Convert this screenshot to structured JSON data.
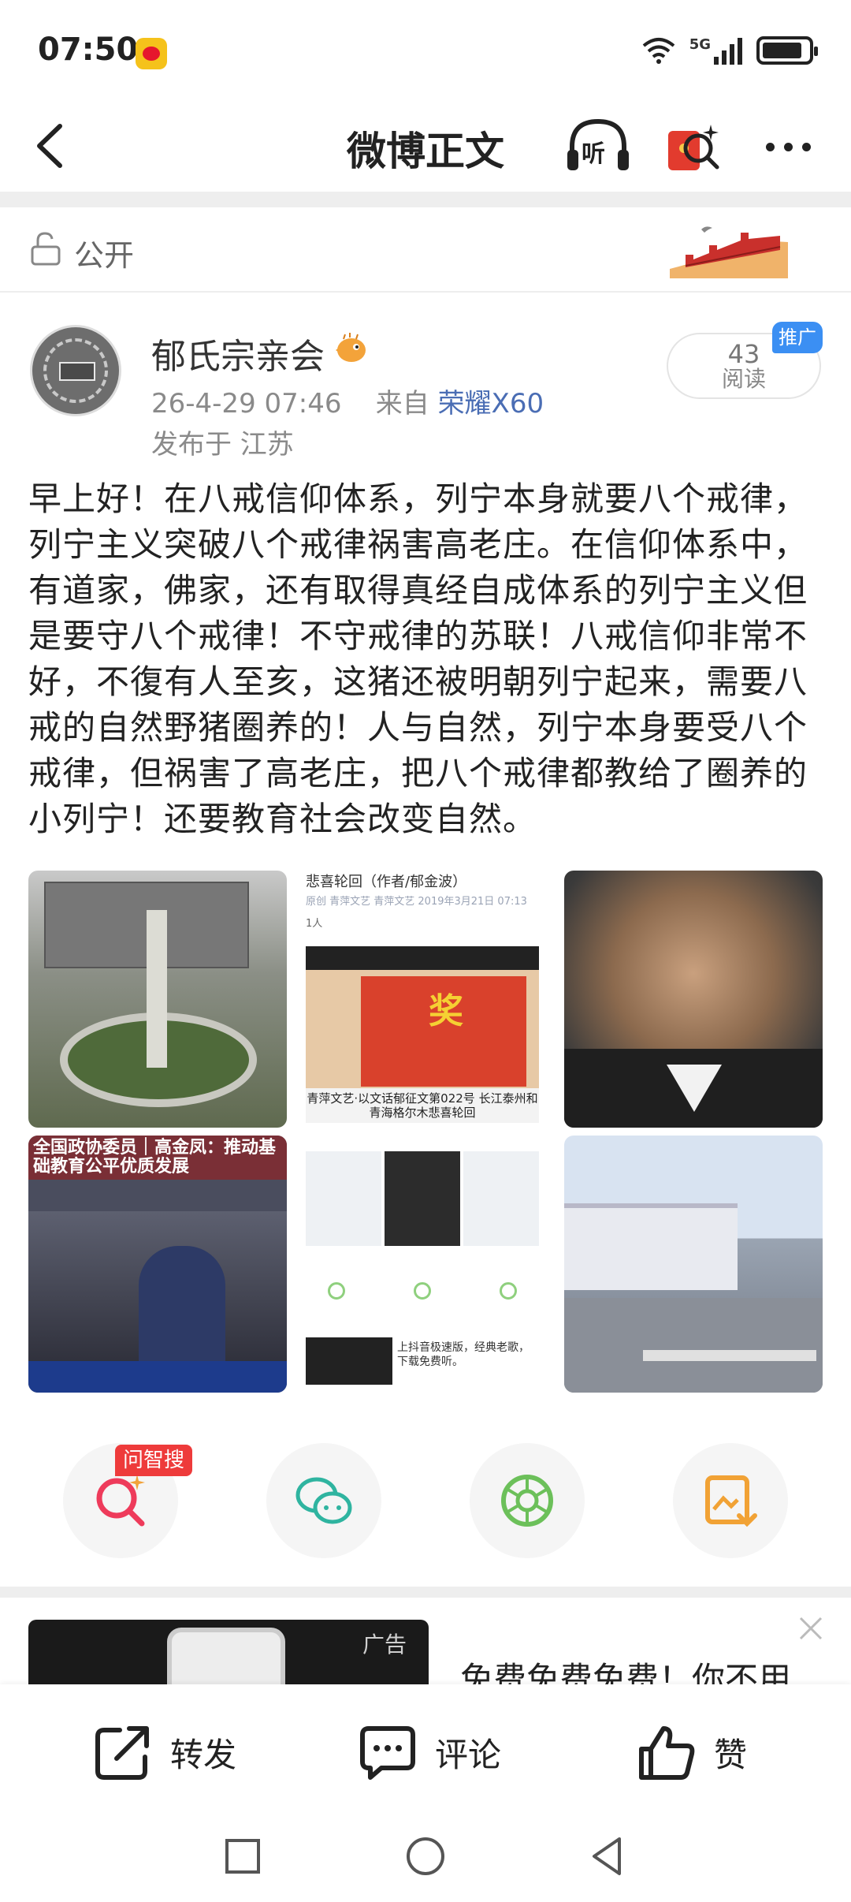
{
  "status_bar": {
    "time": "07:50",
    "network": "5G"
  },
  "header": {
    "title": "微博正文",
    "listen_icon_text": "听",
    "icons": [
      "back-arrow-icon",
      "headphones-listen-icon",
      "red-packet-icon",
      "more-icon"
    ]
  },
  "visibility": {
    "label": "公开"
  },
  "post": {
    "author": "郁氏宗亲会",
    "timestamp": "26-4-29 07:46",
    "source_prefix": "来自",
    "device": "荣耀X60",
    "location": "发布于 江苏",
    "read_count": "43",
    "read_label": "阅读",
    "promo_tag": "推广",
    "text": "早上好！在八戒信仰体系，列宁本身就要八个戒律，列宁主义突破八个戒律祸害高老庄。在信仰体系中，有道家，佛家，还有取得真经自成体系的列宁主义但是要守八个戒律！不守戒律的苏联！八戒信仰非常不好，不復有人至亥，这猪还被明朝列宁起来，需要八戒的自然野猪圈养的！人与自然，列宁本身要受八个戒律，但祸害了高老庄，把八个戒律都教给了圈养的小列宁！还要教育社会改变自然。"
  },
  "images": {
    "img2_caption": "悲喜轮回（作者/郁金波）",
    "img2_sub": "原创 青萍文艺 青萍文艺 2019年3月21日 07:13",
    "img2_listen": "1人",
    "img2_big_char": "奖",
    "img2_bottom": "青萍文艺·以文话郁征文第022号 长江泰州和青海格尔木悲喜轮回",
    "img4_headline": "全国政协委员｜高金凤：推动基础教育公平优质发展",
    "img5_ad_text": "上抖音极速版，经典老歌，下载免费听。"
  },
  "actions": {
    "zhisou_tag": "问智搜",
    "icons": [
      "search-ai-icon",
      "wechat-icon",
      "moments-icon",
      "save-image-icon"
    ]
  },
  "ad": {
    "label": "广告",
    "title": "免费免费免费！你不用"
  },
  "bottom_bar": {
    "repost": "转发",
    "comment": "评论",
    "like": "赞"
  },
  "colors": {
    "accent_blue": "#4a6db4",
    "promo_blue": "#3b8ff3",
    "tag_red": "#ee3b3b",
    "icon_orange": "#f1a235",
    "icon_green": "#6cc05a"
  }
}
